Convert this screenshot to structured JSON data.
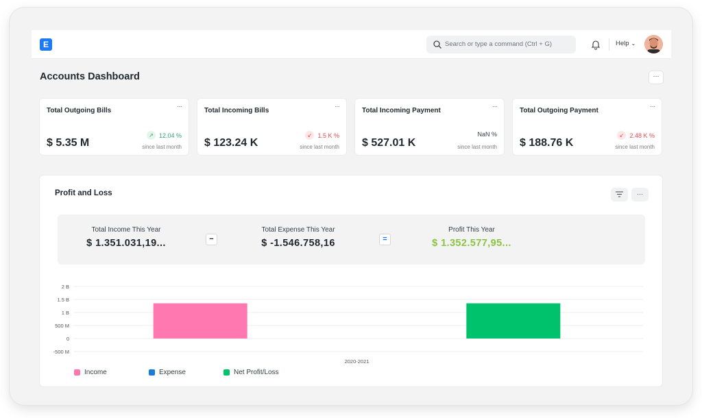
{
  "navbar": {
    "logo_letter": "E",
    "search_placeholder": "Search or type a command (Ctrl + G)",
    "help_label": "Help"
  },
  "page": {
    "title": "Accounts Dashboard",
    "menu_label": "···"
  },
  "cards": [
    {
      "title": "Total Outgoing Bills",
      "value": "$ 5.35 M",
      "change": "12.04 %",
      "trend": "up",
      "arrow": "↗",
      "since": "since last month",
      "menu": "···"
    },
    {
      "title": "Total Incoming Bills",
      "value": "$ 123.24 K",
      "change": "1.5 K %",
      "trend": "down",
      "arrow": "↙",
      "since": "since last month",
      "menu": "···"
    },
    {
      "title": "Total Incoming Payment",
      "value": "$ 527.01 K",
      "change": "NaN %",
      "trend": "neutral",
      "arrow": "",
      "since": "since last month",
      "menu": "···"
    },
    {
      "title": "Total Outgoing Payment",
      "value": "$ 188.76 K",
      "change": "2.48 K %",
      "trend": "down",
      "arrow": "↙",
      "since": "since last month",
      "menu": "···"
    }
  ],
  "profit_loss": {
    "title": "Profit and Loss",
    "menu_label": "···",
    "summary": {
      "income_label": "Total Income This Year",
      "income_value": "$ 1.351.031,19...",
      "minus_op": "−",
      "expense_label": "Total Expense This Year",
      "expense_value": "$ -1.546.758,16",
      "equals_op": "=",
      "profit_label": "Profit This Year",
      "profit_value": "$ 1.352.577,95..."
    }
  },
  "chart_data": {
    "type": "bar",
    "categories": [
      "2020-2021"
    ],
    "series": [
      {
        "name": "Income",
        "values": [
          1351031190
        ],
        "color": "#ff78b0"
      },
      {
        "name": "Expense",
        "values": [
          0
        ],
        "color": "#1c7bd4"
      },
      {
        "name": "Net Profit/Loss",
        "values": [
          1352577950
        ],
        "color": "#00c26c"
      }
    ],
    "ylim": [
      -500000000,
      2000000000
    ],
    "yticks": [
      "-500 M",
      "0",
      "500 M",
      "1 B",
      "1.5 B",
      "2 B"
    ],
    "ytick_values": [
      -500000000,
      0,
      500000000,
      1000000000,
      1500000000,
      2000000000
    ],
    "legend_position": "bottom-left",
    "grid": true
  }
}
